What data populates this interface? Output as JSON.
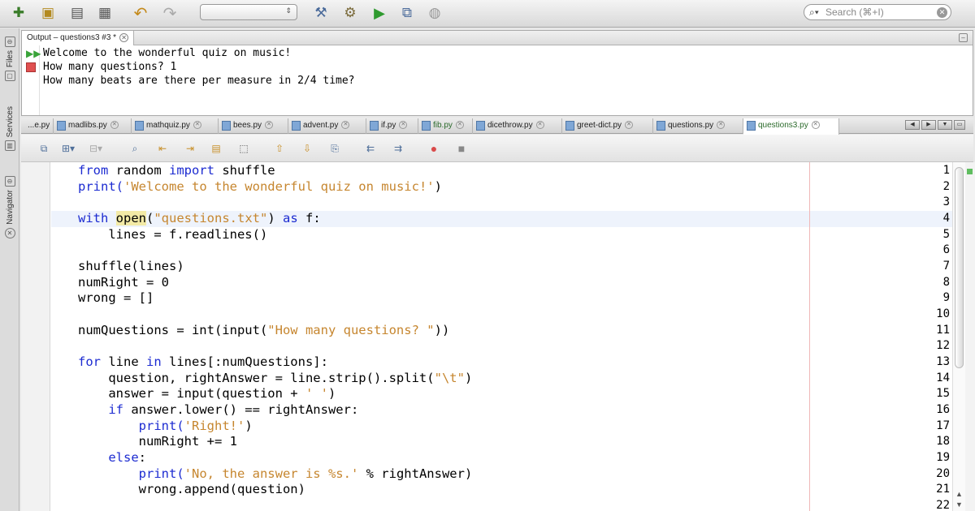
{
  "toolbar": {
    "search_placeholder": "Search (⌘+I)"
  },
  "rail": {
    "files": "Files",
    "services": "Services",
    "navigator": "Navigator"
  },
  "output": {
    "tab_label": "Output – questions3 #3 *",
    "lines": [
      "Welcome to the wonderful quiz on music!",
      "How many questions? 1",
      "How many beats are there per measure in 2/4 time?"
    ]
  },
  "editor_tabs": [
    {
      "label": "...e.py"
    },
    {
      "label": "madlibs.py"
    },
    {
      "label": "mathquiz.py"
    },
    {
      "label": "bees.py"
    },
    {
      "label": "advent.py"
    },
    {
      "label": "if.py"
    },
    {
      "label": "fib.py"
    },
    {
      "label": "dicethrow.py"
    },
    {
      "label": "greet-dict.py"
    },
    {
      "label": "questions.py"
    },
    {
      "label": "questions3.py"
    }
  ],
  "line_numbers": [
    "1",
    "2",
    "3",
    "4",
    "5",
    "6",
    "7",
    "8",
    "9",
    "10",
    "11",
    "12",
    "13",
    "14",
    "15",
    "16",
    "17",
    "18",
    "19",
    "20",
    "21",
    "22"
  ],
  "code": {
    "l1_kw1": "from",
    "l1_t1": " random ",
    "l1_kw2": "import",
    "l1_t2": " shuffle",
    "l2_t1": "print(",
    "l2_s1": "'Welcome to the wonderful quiz on music!'",
    "l2_t2": ")",
    "l4_kw1": "with",
    "l4_t0": " ",
    "l4_hl": "open",
    "l4_t1": "(",
    "l4_s1": "\"questions.txt\"",
    "l4_t2": ") ",
    "l4_kw2": "as",
    "l4_t3": " f:",
    "l5": "    lines = f.readlines()",
    "l7": "shuffle(lines)",
    "l8": "numRight = 0",
    "l9": "wrong = []",
    "l11_t1": "numQuestions = int(input(",
    "l11_s1": "\"How many questions? \"",
    "l11_t2": "))",
    "l13_kw1": "for",
    "l13_t1": " line ",
    "l13_kw2": "in",
    "l13_t2": " lines[:numQuestions]:",
    "l14_t1": "    question, rightAnswer = line.strip().split(",
    "l14_s1": "\"\\t\"",
    "l14_t2": ")",
    "l15_t1": "    answer = input(question + ",
    "l15_s1": "' '",
    "l15_t2": ")",
    "l16_t0": "    ",
    "l16_kw1": "if",
    "l16_t1": " answer.lower() == rightAnswer:",
    "l17_t1": "        print(",
    "l17_s1": "'Right!'",
    "l17_t2": ")",
    "l18": "        numRight += 1",
    "l19_t0": "    ",
    "l19_kw1": "else",
    "l19_t1": ":",
    "l20_t1": "        print(",
    "l20_s1": "'No, the answer is %s.'",
    "l20_t2": " % rightAnswer)",
    "l21": "        wrong.append(question)"
  }
}
